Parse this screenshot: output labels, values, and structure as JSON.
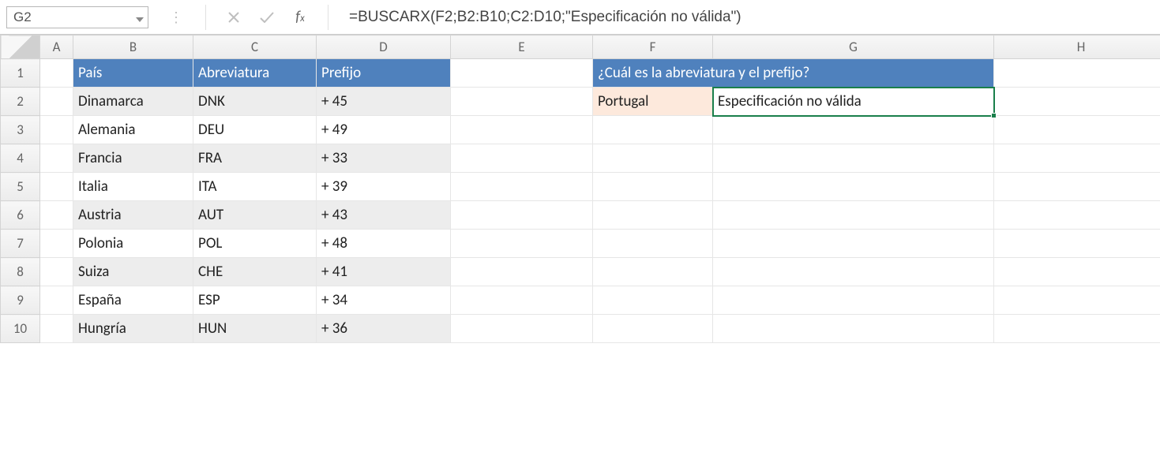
{
  "cell_ref": "G2",
  "formula": "=BUSCARX(F2;B2:B10;C2:D10;\"Especificación no válida\")",
  "columns": [
    "A",
    "B",
    "C",
    "D",
    "E",
    "F",
    "G",
    "H"
  ],
  "rows": [
    "1",
    "2",
    "3",
    "4",
    "5",
    "6",
    "7",
    "8",
    "9",
    "10"
  ],
  "table_header": {
    "pais": "País",
    "abrev": "Abreviatura",
    "prefijo": "Prefijo"
  },
  "question": "¿Cuál es la abreviatura y el prefijo?",
  "lookup_value": "Portugal",
  "lookup_result": "Especificación no válida",
  "countries": [
    {
      "pais": "Dinamarca",
      "abrev": "DNK",
      "prefijo": "+  45"
    },
    {
      "pais": "Alemania",
      "abrev": "DEU",
      "prefijo": "+  49"
    },
    {
      "pais": "Francia",
      "abrev": "FRA",
      "prefijo": "+  33"
    },
    {
      "pais": "Italia",
      "abrev": "ITA",
      "prefijo": "+  39"
    },
    {
      "pais": "Austria",
      "abrev": "AUT",
      "prefijo": "+  43"
    },
    {
      "pais": "Polonia",
      "abrev": "POL",
      "prefijo": "+  48"
    },
    {
      "pais": "Suiza",
      "abrev": "CHE",
      "prefijo": "+  41"
    },
    {
      "pais": "España",
      "abrev": "ESP",
      "prefijo": "+  34"
    },
    {
      "pais": "Hungría",
      "abrev": "HUN",
      "prefijo": "+  36"
    }
  ]
}
